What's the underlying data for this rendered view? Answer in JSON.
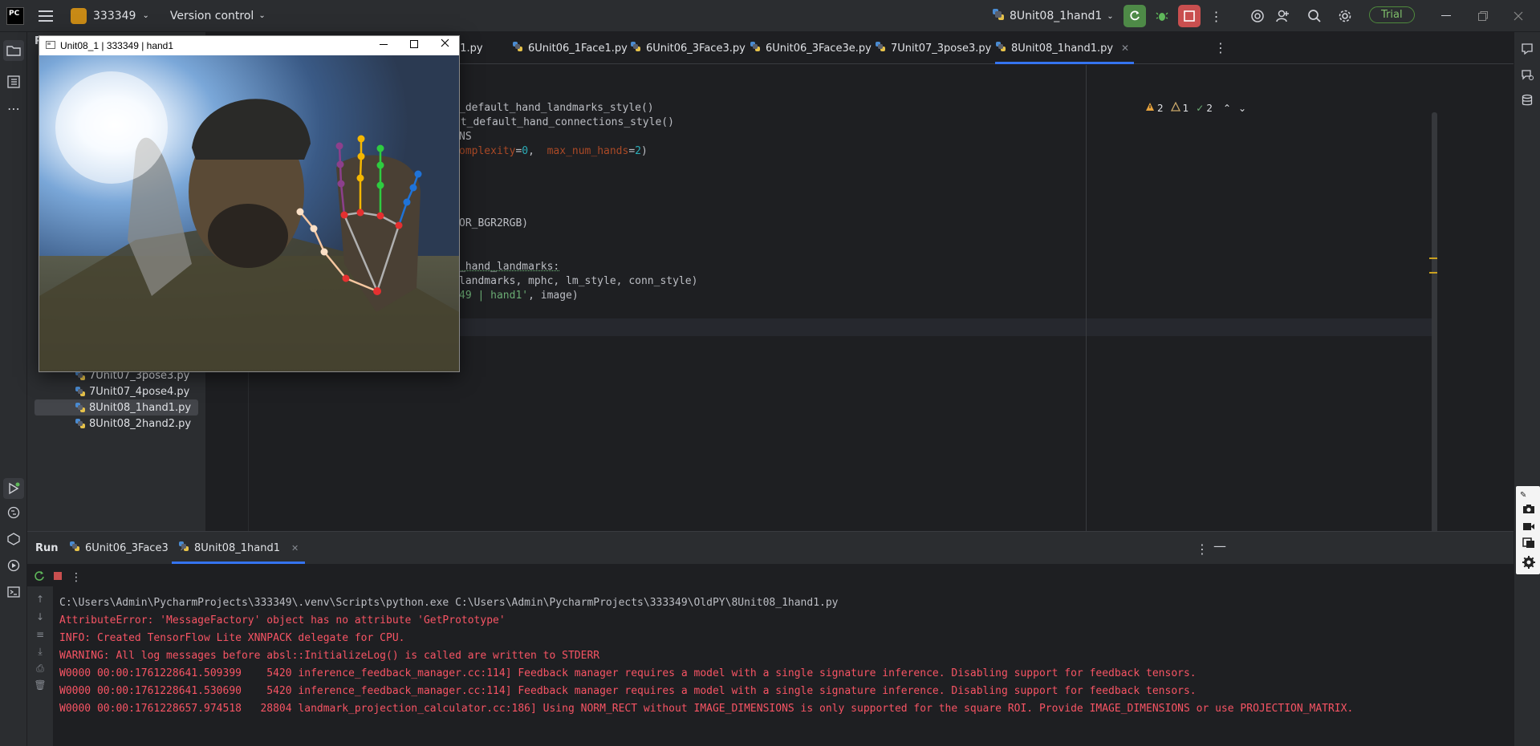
{
  "titlebar": {
    "logo_text": "PC",
    "project_name": "333349",
    "version_control": "Version control",
    "run_config": "8Unit08_1hand1",
    "trial_label": "Trial",
    "colors": {
      "run_green": "#4e8a47",
      "stop_red": "#c94f4f",
      "project_orange": "#c88a16"
    }
  },
  "project_tree": {
    "items": [
      {
        "label": "7Unit07_3pose3.py",
        "selected": false
      },
      {
        "label": "7Unit07_4pose4.py",
        "selected": false
      },
      {
        "label": "8Unit08_1hand1.py",
        "selected": true
      },
      {
        "label": "8Unit08_2hand2.py",
        "selected": false
      }
    ]
  },
  "editor": {
    "tabs": [
      {
        "label": "eg1.py"
      },
      {
        "label": "6Unit06_1Face1.py"
      },
      {
        "label": "6Unit06_3Face3.py"
      },
      {
        "label": "6Unit06_3Face3e.py"
      },
      {
        "label": "7Unit07_3pose3.py"
      },
      {
        "label": "8Unit08_1hand1.py",
        "active": true
      }
    ],
    "warnings": {
      "warn_count": "2",
      "weak_count": "1",
      "ok_count": "2"
    },
    "code_lines": [
      [
        "",
        "_default_hand_landmarks_style()"
      ],
      [
        "",
        "et_default_hand_connections_style()"
      ],
      [
        "",
        "NS"
      ],
      [
        "",
        "omplexity=0,  max_num_hands=2)"
      ],
      [
        "",
        "OR_BGR2RGB)"
      ],
      [
        "",
        "_hand_landmarks:"
      ],
      [
        "",
        "landmarks, mphc, lm_style, conn_style)"
      ],
      [
        "",
        "49 | hand1', image)"
      ]
    ],
    "code_rich": {
      "l4_param1": "omplexity",
      "l4_eq1": "=",
      "l4_n1": "0",
      "l4_sep": ",  ",
      "l4_param2": "max_num_hands",
      "l4_eq2": "=",
      "l4_n2": "2",
      "l4_close": ")",
      "l8_str": "49 | hand1'",
      "l8_rest": ", image)"
    }
  },
  "run_panel": {
    "title": "Run",
    "tabs": [
      {
        "label": "6Unit06_3Face3"
      },
      {
        "label": "8Unit08_1hand1",
        "active": true
      }
    ],
    "console": [
      {
        "type": "cmd",
        "text": "C:\\Users\\Admin\\PycharmProjects\\333349\\.venv\\Scripts\\python.exe C:\\Users\\Admin\\PycharmProjects\\333349\\OldPY\\8Unit08_1hand1.py"
      },
      {
        "type": "err",
        "text": "AttributeError: 'MessageFactory' object has no attribute 'GetPrototype'"
      },
      {
        "type": "err",
        "text": "INFO: Created TensorFlow Lite XNNPACK delegate for CPU."
      },
      {
        "type": "err",
        "text": "WARNING: All log messages before absl::InitializeLog() is called are written to STDERR"
      },
      {
        "type": "err",
        "text": "W0000 00:00:1761228641.509399    5420 inference_feedback_manager.cc:114] Feedback manager requires a model with a single signature inference. Disabling support for feedback tensors."
      },
      {
        "type": "err",
        "text": "W0000 00:00:1761228641.530690    5420 inference_feedback_manager.cc:114] Feedback manager requires a model with a single signature inference. Disabling support for feedback tensors."
      },
      {
        "type": "err",
        "text": "W0000 00:00:1761228657.974518   28804 landmark_projection_calculator.cc:186] Using NORM_RECT without IMAGE_DIMENSIONS is only supported for the square ROI. Provide IMAGE_DIMENSIONS or use PROJECTION_MATRIX."
      }
    ]
  },
  "cv_window": {
    "title": "Unit08_1 | 333349 | hand1"
  }
}
